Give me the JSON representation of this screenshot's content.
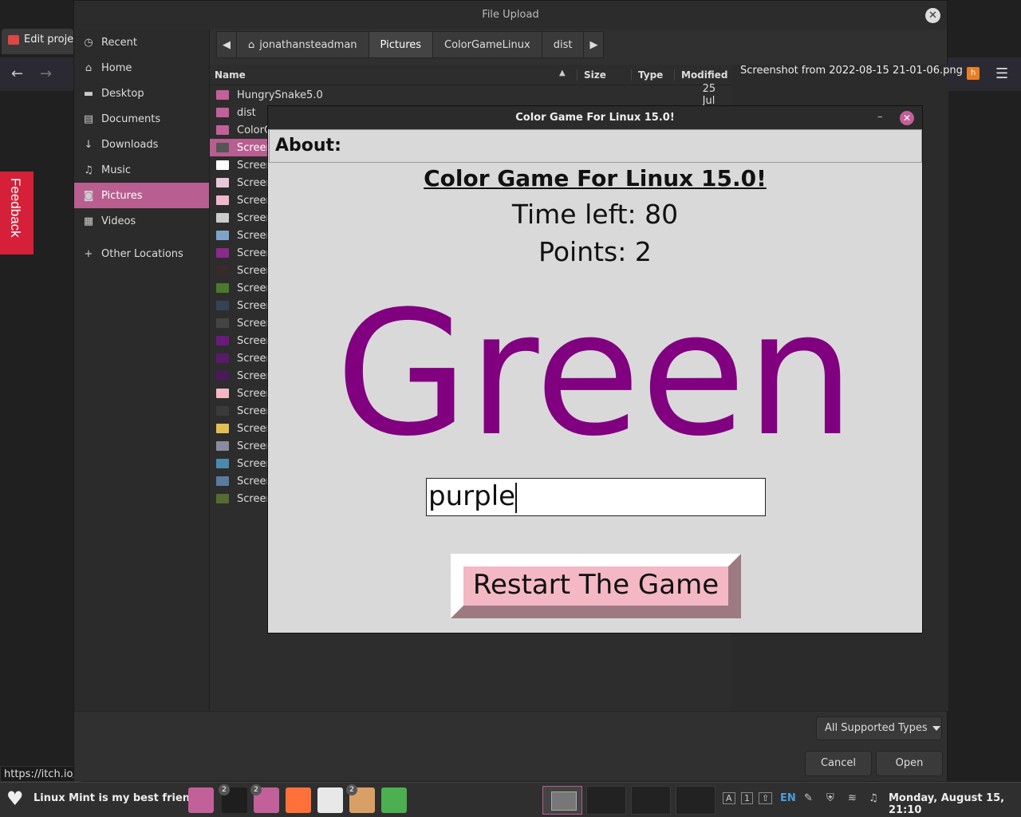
{
  "browser": {
    "tab_label": "Edit proje",
    "status_url": "https://itch.io/",
    "feedback_label": "Feedback",
    "back_glyph": "←",
    "forward_glyph": "→",
    "menu_glyph": "☰"
  },
  "dialog": {
    "title": "File Upload",
    "close_glyph": "✕",
    "sidebar": [
      {
        "label": "Recent",
        "icon": "clock-icon",
        "glyph": "◷"
      },
      {
        "label": "Home",
        "icon": "home-icon",
        "glyph": "⌂"
      },
      {
        "label": "Desktop",
        "icon": "folder-icon",
        "glyph": "▬"
      },
      {
        "label": "Documents",
        "icon": "document-icon",
        "glyph": "▤"
      },
      {
        "label": "Downloads",
        "icon": "download-icon",
        "glyph": "↓"
      },
      {
        "label": "Music",
        "icon": "music-icon",
        "glyph": "♫"
      },
      {
        "label": "Pictures",
        "icon": "camera-icon",
        "glyph": "◙"
      },
      {
        "label": "Videos",
        "icon": "film-icon",
        "glyph": "▦"
      },
      {
        "label": "Other Locations",
        "icon": "plus-icon",
        "glyph": "+"
      }
    ],
    "path": [
      "jonathansteadman",
      "Pictures",
      "ColorGameLinux",
      "dist"
    ],
    "path_back_glyph": "◀",
    "path_forward_glyph": "▶",
    "home_glyph": "⌂",
    "columns": {
      "name": "Name",
      "size": "Size",
      "type": "Type",
      "modified": "Modified",
      "sort_glyph": "▲"
    },
    "files": [
      {
        "name": "HungrySnake5.0",
        "modified": "25 Jul",
        "kind": "folder"
      },
      {
        "name": "dist",
        "modified": "",
        "kind": "folder"
      },
      {
        "name": "ColorC",
        "modified": "",
        "kind": "folder"
      },
      {
        "name": "Screen",
        "modified": "",
        "kind": "image",
        "color": "#555555",
        "selected": true
      },
      {
        "name": "Screen",
        "modified": "",
        "kind": "image",
        "color": "#ffffff"
      },
      {
        "name": "Screen",
        "modified": "",
        "kind": "image",
        "color": "#e8c7d6"
      },
      {
        "name": "Screen",
        "modified": "",
        "kind": "image",
        "color": "#f0b8cc"
      },
      {
        "name": "Screen",
        "modified": "",
        "kind": "image",
        "color": "#cccccc"
      },
      {
        "name": "Screen",
        "modified": "",
        "kind": "image",
        "color": "#7fa2c9"
      },
      {
        "name": "Screen",
        "modified": "",
        "kind": "image",
        "color": "#8a2a8a"
      },
      {
        "name": "Screen",
        "modified": "",
        "kind": "image",
        "color": "#3a2a2a"
      },
      {
        "name": "Screen",
        "modified": "",
        "kind": "image",
        "color": "#4a7a2a"
      },
      {
        "name": "Screen",
        "modified": "",
        "kind": "image",
        "color": "#334455"
      },
      {
        "name": "Screen",
        "modified": "",
        "kind": "image",
        "color": "#444444"
      },
      {
        "name": "Screen",
        "modified": "",
        "kind": "image",
        "color": "#6a1a7a"
      },
      {
        "name": "Screen",
        "modified": "",
        "kind": "image",
        "color": "#5a1a6a"
      },
      {
        "name": "Screen",
        "modified": "",
        "kind": "image",
        "color": "#4a1a5a"
      },
      {
        "name": "Screen",
        "modified": "",
        "kind": "image",
        "color": "#f4b8c4"
      },
      {
        "name": "Screen",
        "modified": "",
        "kind": "image",
        "color": "#3a3a3a"
      },
      {
        "name": "Screen",
        "modified": "",
        "kind": "image",
        "color": "#e0c050"
      },
      {
        "name": "Screen",
        "modified": "",
        "kind": "image",
        "color": "#8a8aa0"
      },
      {
        "name": "Screen",
        "modified": "",
        "kind": "image",
        "color": "#4a8aaa"
      },
      {
        "name": "Screen",
        "modified": "",
        "kind": "image",
        "color": "#5a7aa0"
      },
      {
        "name": "Screen",
        "modified": "",
        "kind": "image",
        "color": "#556b2f"
      }
    ],
    "preview_name": "Screenshot from 2022-08-15 21-01-06.png",
    "file_types": "All Supported Types",
    "cancel_label": "Cancel",
    "open_label": "Open"
  },
  "game": {
    "window_title": "Color Game For Linux 15.0!",
    "min_glyph": "–",
    "close_glyph": "✕",
    "menu_about": "About:",
    "heading": "Color Game For Linux 15.0!",
    "time_left": "Time left: 80",
    "points": "Points: 2",
    "word": "Green",
    "word_color": "#800080",
    "entry_value": "purple",
    "restart_label": "Restart The Game"
  },
  "taskbar": {
    "heart_glyph": "♥",
    "label": "Linux Mint is my best friend.",
    "apps": [
      {
        "name": "files-app",
        "color": "#c2609a",
        "badge": ""
      },
      {
        "name": "terminal-app",
        "color": "#1e1e1e",
        "badge": "2"
      },
      {
        "name": "folder-app",
        "color": "#c2609a",
        "badge": "2"
      },
      {
        "name": "firefox-app",
        "color": "#ff7139",
        "badge": ""
      },
      {
        "name": "itch-app",
        "color": "#e8e8e8",
        "badge": ""
      },
      {
        "name": "archive-app",
        "color": "#d9a066",
        "badge": "2"
      },
      {
        "name": "colorgame-app",
        "color": "#4caf50",
        "badge": ""
      }
    ],
    "lang": "EN",
    "clock": "Monday, August 15, 21:10",
    "tray_glyphs": [
      "A",
      "1",
      "⇧"
    ],
    "pen_glyph": "✎",
    "shield_glyph": "⛨",
    "wifi_glyph": "≋",
    "music_glyph": "♫"
  }
}
